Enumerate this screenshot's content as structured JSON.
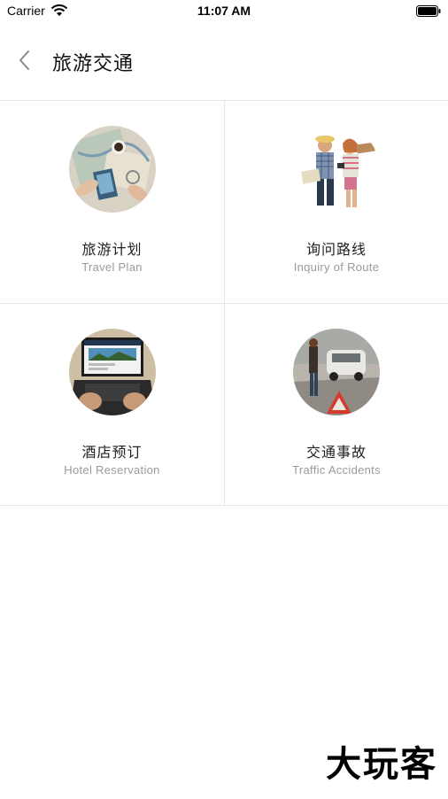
{
  "status_bar": {
    "carrier": "Carrier",
    "time": "11:07 AM"
  },
  "nav": {
    "title": "旅游交通"
  },
  "cards": [
    {
      "title": "旅游计划",
      "subtitle": "Travel Plan"
    },
    {
      "title": "询问路线",
      "subtitle": "Inquiry of Route"
    },
    {
      "title": "酒店预订",
      "subtitle": "Hotel Reservation"
    },
    {
      "title": "交通事故",
      "subtitle": "Traffic Accidents"
    }
  ],
  "watermark": "大玩客",
  "icons": [
    "wifi-icon",
    "battery-icon",
    "back-chevron-icon"
  ],
  "colors": {
    "divider": "#e6e6e6",
    "subtitle": "#9a9a9a",
    "title": "#222222"
  }
}
